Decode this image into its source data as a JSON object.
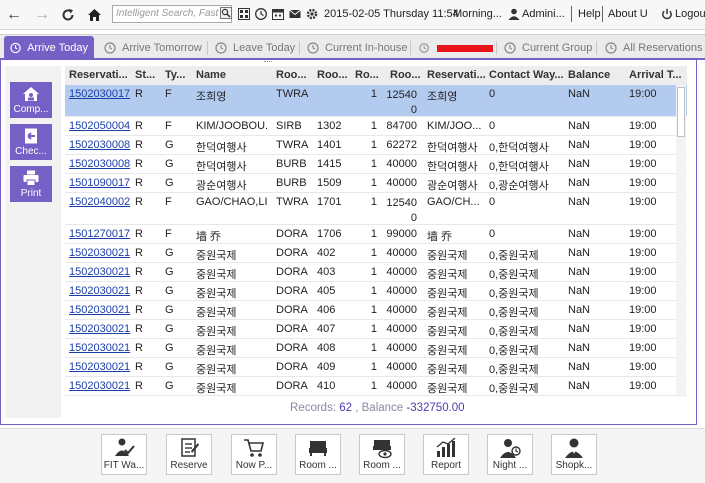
{
  "topbar": {
    "search_placeholder": "Intelligent Search, Fast",
    "datetime": "2015-02-05 Thursday 11:54",
    "shift": "Morning...",
    "user": "Admini...",
    "help": "Help",
    "about": "About U",
    "logout": "Logout"
  },
  "tabs": [
    {
      "label": "Arrive Today"
    },
    {
      "label": "Arrive Tomorrow"
    },
    {
      "label": "Leave Today"
    },
    {
      "label": "Current In-house"
    },
    {
      "label": ""
    },
    {
      "label": "Current Group"
    },
    {
      "label": "All Reservations"
    }
  ],
  "sidebar": {
    "comp": "Comp...",
    "check": "Chec...",
    "print": "Print"
  },
  "table": {
    "columns": [
      "Reservati...",
      "St...",
      "Ty...",
      "Name",
      "Roo...",
      "Roo...",
      "Ro...",
      "Roo...",
      "Reservati...",
      "Contact Way...",
      "Balance",
      "Arrival T..."
    ],
    "rows": [
      {
        "res": "1502030017",
        "st": "R",
        "ty": "F",
        "name": "조희영",
        "rtype": "TWRA",
        "room": "",
        "rc": "1",
        "rate": "125400",
        "rname": "조희영",
        "contact": "0",
        "bal": "NaN",
        "arr": "19:00"
      },
      {
        "res": "1502050004",
        "st": "R",
        "ty": "F",
        "name": "KIM/JOOBOU...",
        "rtype": "SIRB",
        "room": "1302",
        "rc": "1",
        "rate": "84700",
        "rname": "KIM/JOO...",
        "contact": "0",
        "bal": "NaN",
        "arr": "19:00"
      },
      {
        "res": "1502030008",
        "st": "R",
        "ty": "G",
        "name": "한덕여행사",
        "rtype": "TWRA",
        "room": "1401",
        "rc": "1",
        "rate": "62272",
        "rname": "한덕여행사",
        "contact": "0,한덕여행사",
        "bal": "NaN",
        "arr": "19:00"
      },
      {
        "res": "1502030008",
        "st": "R",
        "ty": "G",
        "name": "한덕여행사",
        "rtype": "BURB",
        "room": "1415",
        "rc": "1",
        "rate": "40000",
        "rname": "한덕여행사",
        "contact": "0,한덕여행사",
        "bal": "NaN",
        "arr": "19:00"
      },
      {
        "res": "1501090017",
        "st": "R",
        "ty": "G",
        "name": "광순여행사",
        "rtype": "BURB",
        "room": "1509",
        "rc": "1",
        "rate": "40000",
        "rname": "광순여행사",
        "contact": "0,광순여행사",
        "bal": "NaN",
        "arr": "19:00"
      },
      {
        "res": "1502040002",
        "st": "R",
        "ty": "F",
        "name": "GAO/CHAO,LI...",
        "rtype": "TWRA",
        "room": "1701",
        "rc": "1",
        "rate": "125400",
        "rname": "GAO/CH...",
        "contact": "0",
        "bal": "NaN",
        "arr": "19:00"
      },
      {
        "res": "1501270017",
        "st": "R",
        "ty": "F",
        "name": "墙 乔",
        "rtype": "DORA",
        "room": "1706",
        "rc": "1",
        "rate": "99000",
        "rname": "墙 乔",
        "contact": "0",
        "bal": "NaN",
        "arr": "19:00"
      },
      {
        "res": "1502030021",
        "st": "R",
        "ty": "G",
        "name": "중원국제",
        "rtype": "DORA",
        "room": "402",
        "rc": "1",
        "rate": "40000",
        "rname": "중원국제",
        "contact": "0,중원국제",
        "bal": "NaN",
        "arr": "19:00"
      },
      {
        "res": "1502030021",
        "st": "R",
        "ty": "G",
        "name": "중원국제",
        "rtype": "DORA",
        "room": "403",
        "rc": "1",
        "rate": "40000",
        "rname": "중원국제",
        "contact": "0,중원국제",
        "bal": "NaN",
        "arr": "19:00"
      },
      {
        "res": "1502030021",
        "st": "R",
        "ty": "G",
        "name": "중원국제",
        "rtype": "DORA",
        "room": "405",
        "rc": "1",
        "rate": "40000",
        "rname": "중원국제",
        "contact": "0,중원국제",
        "bal": "NaN",
        "arr": "19:00"
      },
      {
        "res": "1502030021",
        "st": "R",
        "ty": "G",
        "name": "중원국제",
        "rtype": "DORA",
        "room": "406",
        "rc": "1",
        "rate": "40000",
        "rname": "중원국제",
        "contact": "0,중원국제",
        "bal": "NaN",
        "arr": "19:00"
      },
      {
        "res": "1502030021",
        "st": "R",
        "ty": "G",
        "name": "중원국제",
        "rtype": "DORA",
        "room": "407",
        "rc": "1",
        "rate": "40000",
        "rname": "중원국제",
        "contact": "0,중원국제",
        "bal": "NaN",
        "arr": "19:00"
      },
      {
        "res": "1502030021",
        "st": "R",
        "ty": "G",
        "name": "중원국제",
        "rtype": "DORA",
        "room": "408",
        "rc": "1",
        "rate": "40000",
        "rname": "중원국제",
        "contact": "0,중원국제",
        "bal": "NaN",
        "arr": "19:00"
      },
      {
        "res": "1502030021",
        "st": "R",
        "ty": "G",
        "name": "중원국제",
        "rtype": "DORA",
        "room": "409",
        "rc": "1",
        "rate": "40000",
        "rname": "중원국제",
        "contact": "0,중원국제",
        "bal": "NaN",
        "arr": "19:00"
      },
      {
        "res": "1502030021",
        "st": "R",
        "ty": "G",
        "name": "중원국제",
        "rtype": "DORA",
        "room": "410",
        "rc": "1",
        "rate": "40000",
        "rname": "중원국제",
        "contact": "0,중원국제",
        "bal": "NaN",
        "arr": "19:00"
      }
    ]
  },
  "footer": {
    "records_label": "Records:",
    "records_value": "62",
    "balance_label": ", Balance",
    "balance_value": "-332750.00"
  },
  "bottom_buttons": [
    {
      "label": "FIT Wa...",
      "icon": "fit-walkin-icon"
    },
    {
      "label": "Reserve",
      "icon": "reserve-icon"
    },
    {
      "label": "Now P...",
      "icon": "cart-icon"
    },
    {
      "label": "Room ...",
      "icon": "bed-icon"
    },
    {
      "label": "Room ...",
      "icon": "room-view-icon"
    },
    {
      "label": "Report",
      "icon": "report-chart-icon"
    },
    {
      "label": "Night ...",
      "icon": "night-audit-icon"
    },
    {
      "label": "Shopk...",
      "icon": "shopkeeper-icon"
    }
  ],
  "colors": {
    "accent": "#7561c6",
    "selected_row": "#b4cbf0",
    "link": "#1a3fa8",
    "redacted": "#e8141a"
  }
}
